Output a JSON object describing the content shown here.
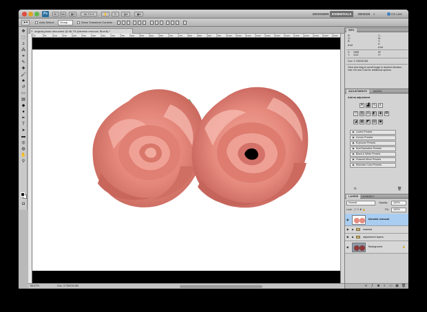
{
  "app": {
    "logo": "Ps",
    "zoom_select": "66.7%",
    "workspaces": [
      "DESIGNER",
      "ESSENTIALS",
      "DESIGN",
      "PAINTING"
    ],
    "active_workspace": "ESSENTIALS",
    "cs_live": "CS Live"
  },
  "options_bar": {
    "auto_select_label": "Auto-Select:",
    "auto_select_value": "Group",
    "show_transform_label": "Show Transform Controls"
  },
  "document": {
    "tab_title": "original-photo-retouched @ 66.7% (blemish removal, Blue/8) *",
    "ruler_marks": [
      "0",
      "50",
      "100",
      "150",
      "200",
      "250",
      "300",
      "350",
      "400",
      "450",
      "500",
      "550",
      "600",
      "650",
      "700",
      "750",
      "800",
      "850",
      "900",
      "950",
      "1000",
      "1050",
      "1100",
      "1150",
      "1200",
      "1250",
      "1300",
      "1350",
      "1400",
      "1450",
      "1500",
      "1550"
    ],
    "status_zoom": "66.67%",
    "status_doc": "Doc: 3.70M/30.8M"
  },
  "info_panel": {
    "tabs": [
      "INFO"
    ],
    "r_label": "R:",
    "g_label": "G:",
    "b_label": "B:",
    "c_label": "C:",
    "m_label": "M:",
    "y_label": "Y:",
    "k_label": "K:",
    "bit_left": "8-bit",
    "bit_right": "8-bit",
    "x_label": "X:",
    "y2_label": "Y:",
    "w_label": "W:",
    "h_label": "H:",
    "x_value": "1568",
    "y_value": "1114",
    "doc_line": "Doc: 3.70M/30.8M",
    "hint": "Click and drag to scroll image in desired direction. Use Ctrl and Cmd for additional options."
  },
  "adjustments_panel": {
    "tabs": [
      "ADJUSTMENTS",
      "MASKS"
    ],
    "heading": "Add an adjustment",
    "presets": [
      "Levels Presets",
      "Curves Presets",
      "Exposure Presets",
      "Hue/Saturation Presets",
      "Black & White Presets",
      "Channel Mixer Presets",
      "Selective Color Presets"
    ]
  },
  "layers_panel": {
    "tabs": [
      "LAYERS",
      "CHANNELS",
      "PATHS"
    ],
    "blend_mode": "Normal",
    "opacity_label": "Opacity:",
    "opacity_value": "100%",
    "lock_label": "Lock:",
    "fill_label": "Fill:",
    "fill_value": "100%",
    "layers": [
      {
        "name": "blemish removal",
        "selected": true,
        "type": "image"
      },
      {
        "name": "masked",
        "selected": false,
        "type": "group"
      },
      {
        "name": "adjustment layers",
        "selected": false,
        "type": "group"
      },
      {
        "name": "Background",
        "selected": false,
        "type": "image"
      }
    ]
  },
  "colors": {
    "accent": "#a9cdf1",
    "rose": "#e68a7f",
    "stem": "#4e8f5d"
  }
}
